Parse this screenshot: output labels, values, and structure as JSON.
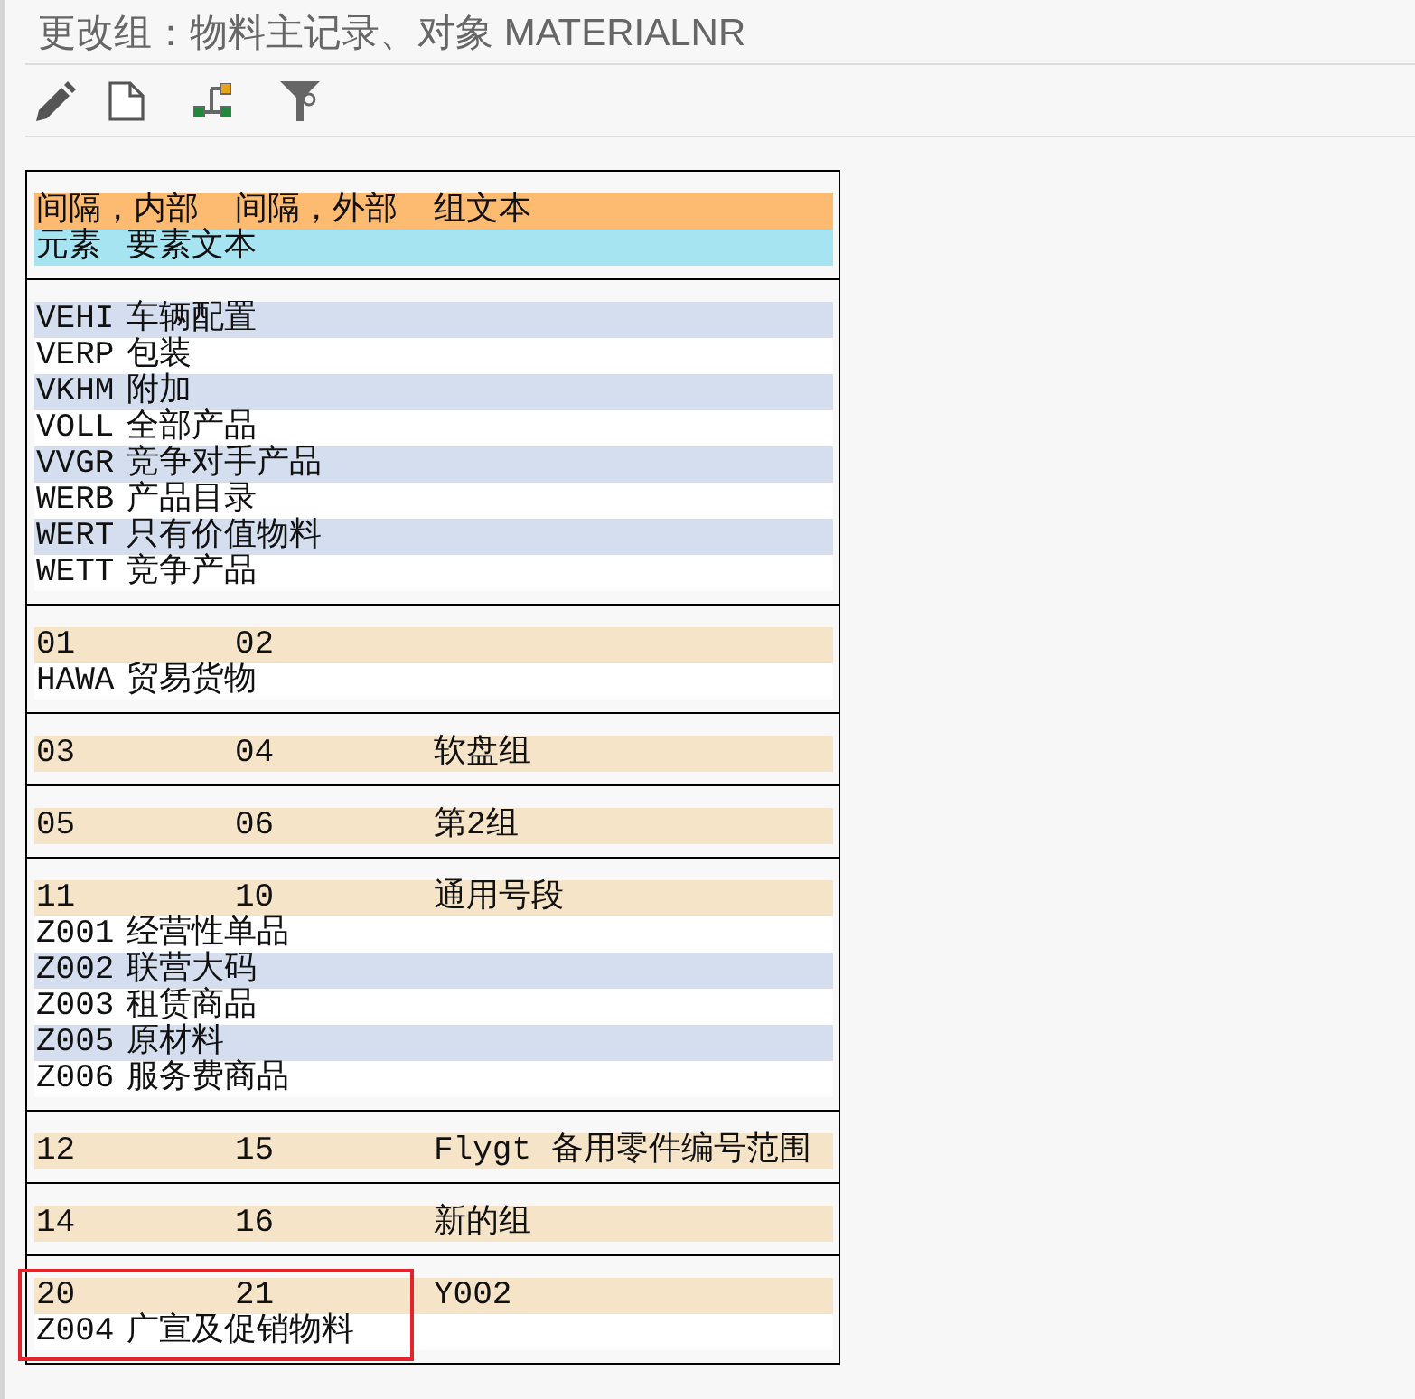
{
  "title": "更改组：物料主记录、对象 MATERIALNR",
  "legend": [
    {
      "kind": "group",
      "texts": [
        "间隔，内部",
        "间隔，外部",
        "组文本"
      ]
    },
    {
      "kind": "element",
      "texts": [
        "元素",
        "要素文本"
      ]
    }
  ],
  "sections": [
    {
      "highlighted": false,
      "elements": [
        {
          "code": "VEHI",
          "text": "车辆配置"
        },
        {
          "code": "VERP",
          "text": "包装"
        },
        {
          "code": "VKHM",
          "text": "附加"
        },
        {
          "code": "VOLL",
          "text": "全部产品"
        },
        {
          "code": "VVGR",
          "text": "竞争对手产品"
        },
        {
          "code": "WERB",
          "text": "产品目录"
        },
        {
          "code": "WERT",
          "text": "只有价值物料"
        },
        {
          "code": "WETT",
          "text": "竞争产品"
        }
      ]
    },
    {
      "highlighted": false,
      "group": {
        "internal": "01",
        "external": "02"
      },
      "elements": [
        {
          "code": "HAWA",
          "text": "贸易货物"
        }
      ]
    },
    {
      "highlighted": false,
      "group": {
        "internal": "03",
        "external": "04",
        "text": "软盘组"
      }
    },
    {
      "highlighted": false,
      "group": {
        "internal": "05",
        "external": "06",
        "text": "第2组"
      }
    },
    {
      "highlighted": false,
      "group": {
        "internal": "11",
        "external": "10",
        "text": "通用号段"
      },
      "elements": [
        {
          "code": "Z001",
          "text": "经营性单品"
        },
        {
          "code": "Z002",
          "text": "联营大码"
        },
        {
          "code": "Z003",
          "text": "租赁商品"
        },
        {
          "code": "Z005",
          "text": "原材料"
        },
        {
          "code": "Z006",
          "text": "服务费商品"
        }
      ]
    },
    {
      "highlighted": false,
      "group": {
        "internal": "12",
        "external": "15",
        "text": "Flygt 备用零件编号范围"
      }
    },
    {
      "highlighted": false,
      "group": {
        "internal": "14",
        "external": "16",
        "text": "新的组"
      }
    },
    {
      "highlighted": true,
      "group": {
        "internal": "20",
        "external": "21",
        "text": "Y002"
      },
      "elements": [
        {
          "code": "Z004",
          "text": "广宣及促销物料"
        }
      ]
    }
  ]
}
